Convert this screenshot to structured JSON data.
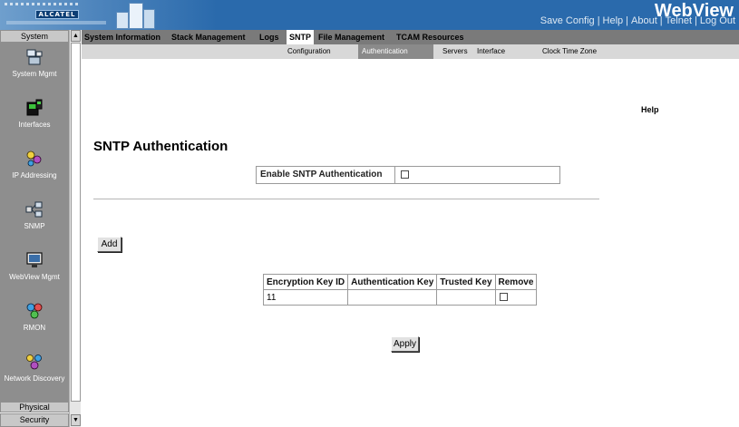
{
  "header": {
    "logo_text": "ALCATEL",
    "brand": "WebView",
    "links": [
      "Save Config",
      "Help",
      "About",
      "Telnet",
      "Log Out"
    ],
    "colors": {
      "bar": "#2a6aac",
      "gradient_light": "#6f9fcd"
    }
  },
  "sidebar": {
    "title": "System",
    "items": [
      {
        "label": "System Mgmt",
        "icon": "system-mgmt-icon"
      },
      {
        "label": "Interfaces",
        "icon": "interfaces-icon"
      },
      {
        "label": "IP Addressing",
        "icon": "ip-addressing-icon"
      },
      {
        "label": "SNMP",
        "icon": "snmp-icon"
      },
      {
        "label": "WebView Mgmt",
        "icon": "webview-mgmt-icon"
      },
      {
        "label": "RMON",
        "icon": "rmon-icon"
      },
      {
        "label": "Network Discovery",
        "icon": "network-discovery-icon"
      }
    ],
    "physical": "Physical",
    "security": "Security"
  },
  "tabs": {
    "primary": [
      "System Information",
      "Stack Management",
      "Logs",
      "SNTP",
      "File Management",
      "TCAM Resources"
    ],
    "primary_active": "SNTP",
    "secondary": [
      "Configuration",
      "Authentication",
      "Servers",
      "Interface",
      "Clock Time Zone"
    ],
    "secondary_active": "Authentication"
  },
  "main": {
    "help": "Help",
    "title": "SNTP Authentication",
    "enable_label": "Enable SNTP Authentication",
    "enable_checked": false,
    "add_label": "Add",
    "apply_label": "Apply",
    "table": {
      "headers": [
        "Encryption Key ID",
        "Authentication Key",
        "Trusted Key",
        "Remove"
      ],
      "rows": [
        {
          "key_id": "11",
          "auth_key": "",
          "trusted": "",
          "remove": false
        }
      ]
    }
  }
}
